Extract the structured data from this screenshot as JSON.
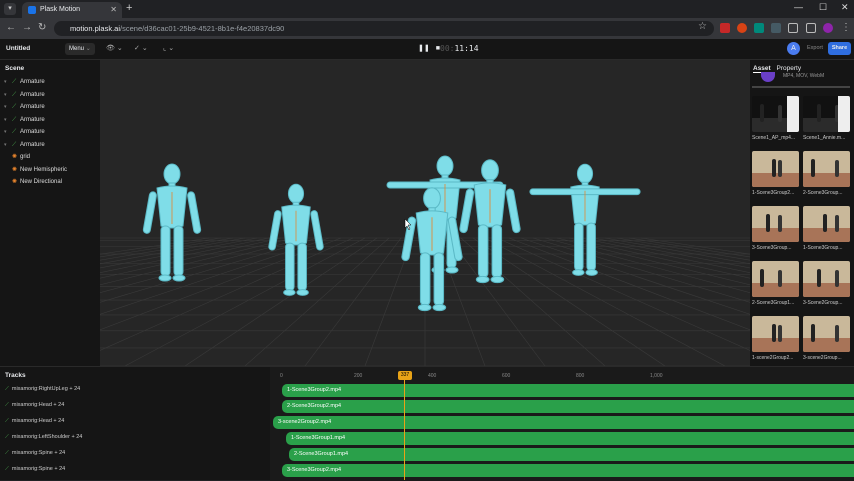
{
  "browser": {
    "tab_title": "Plask Motion",
    "url_host": "motion.plask.ai",
    "url_path": "/scene/d36cac01-25b9-4521-8b1e-f4e20837dc90"
  },
  "app": {
    "project_name": "Untitled",
    "menu_label": "Menu",
    "timecode_dim": "00:",
    "timecode": "11:14",
    "avatar_letter": "A",
    "export_label": "Export",
    "share_label": "Share"
  },
  "scene": {
    "title": "Scene",
    "items": [
      {
        "label": "Armature"
      },
      {
        "label": "Armature"
      },
      {
        "label": "Armature"
      },
      {
        "label": "Armature"
      },
      {
        "label": "Armature"
      },
      {
        "label": "Armature"
      },
      {
        "label": "grid"
      },
      {
        "label": "New Hemispheric"
      },
      {
        "label": "New Directional"
      }
    ]
  },
  "assets": {
    "tab_asset": "Asset",
    "tab_property": "Property",
    "formats_note": "MP4, MOV, WebM",
    "thumbs": [
      {
        "caption": "Scene1_AP_mp4..."
      },
      {
        "caption": "Scene1_Annie.m..."
      },
      {
        "caption": "1-Scene3Group2..."
      },
      {
        "caption": "2-Scene3Group..."
      },
      {
        "caption": "3-Scene3Group..."
      },
      {
        "caption": "1-Scene3Group..."
      },
      {
        "caption": "2-Scene3Group1..."
      },
      {
        "caption": "3-Scene2Group..."
      },
      {
        "caption": "1-scene2Group2..."
      },
      {
        "caption": "3-scene2Group..."
      }
    ]
  },
  "tracks": {
    "title": "Tracks",
    "labels": [
      "mixamorig:RightUpLeg + 24",
      "mixamorig:Head + 24",
      "mixamorig:Head + 24",
      "mixamorig:LeftShoulder + 24",
      "mixamorig:Spine + 24",
      "mixamorig:Spine + 24"
    ],
    "ruler": [
      "0",
      "200",
      "400",
      "600",
      "800",
      "1,000"
    ],
    "playhead_frame": "337",
    "clips": [
      "1-Scene3Group2.mp4",
      "2-Scene3Group2.mp4",
      "3-scene2Group2.mp4",
      "1-Scene3Group1.mp4",
      "2-Scene3Group1.mp4",
      "3-Scene3Group2.mp4"
    ]
  }
}
